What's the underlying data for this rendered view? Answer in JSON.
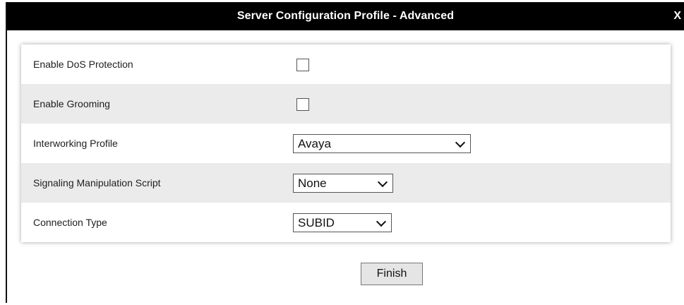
{
  "dialog": {
    "title": "Server Configuration Profile - Advanced",
    "close_label": "X"
  },
  "form": {
    "rows": [
      {
        "label": "Enable DoS Protection",
        "type": "checkbox",
        "checked": false
      },
      {
        "label": "Enable Grooming",
        "type": "checkbox",
        "checked": false
      },
      {
        "label": "Interworking Profile",
        "type": "select",
        "value": "Avaya"
      },
      {
        "label": "Signaling Manipulation Script",
        "type": "select",
        "value": "None"
      },
      {
        "label": "Connection Type",
        "type": "select",
        "value": "SUBID"
      }
    ]
  },
  "footer": {
    "finish_label": "Finish"
  }
}
